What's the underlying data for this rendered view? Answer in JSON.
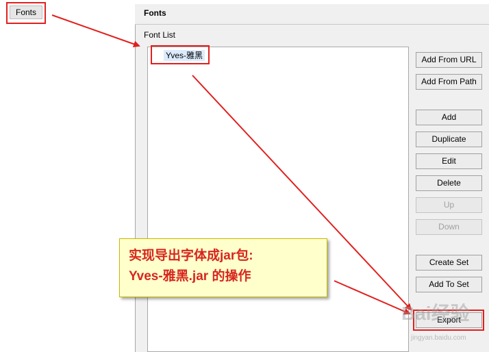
{
  "sidebar": {
    "fonts_tab": "Fonts"
  },
  "panel": {
    "title": "Fonts",
    "list_label": "Font List",
    "font_items": [
      "Yves-雅黑"
    ]
  },
  "buttons": {
    "add_from_url": "Add From URL",
    "add_from_path": "Add From Path",
    "add": "Add",
    "duplicate": "Duplicate",
    "edit": "Edit",
    "delete": "Delete",
    "up": "Up",
    "down": "Down",
    "create_set": "Create Set",
    "add_to_set": "Add To Set",
    "export": "Export"
  },
  "annotation": {
    "line1": "实现导出字体成jar包:",
    "line2": "Yves-雅黑.jar 的操作",
    "highlight_color": "#e0201e"
  },
  "watermark": {
    "brand": "Bai经验",
    "url": "jingyan.baidu.com"
  }
}
